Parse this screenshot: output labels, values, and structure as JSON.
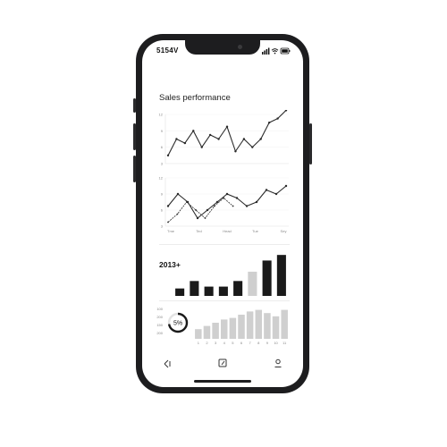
{
  "status": {
    "time": "5154V"
  },
  "page": {
    "title": "Sales performance"
  },
  "chart_data": [
    {
      "type": "line",
      "y_ticks": [
        "12",
        "9",
        "6",
        "3"
      ],
      "ylim": [
        0,
        12
      ],
      "series": [
        {
          "values": [
            2,
            6,
            5,
            8,
            4,
            7,
            6,
            9,
            3,
            6,
            4,
            6,
            10,
            11,
            13
          ]
        }
      ]
    },
    {
      "type": "line",
      "y_ticks": [
        "12",
        "9",
        "6",
        "3"
      ],
      "categories": [
        "Tme",
        "Ted",
        "Head",
        "Tue",
        "Sey"
      ],
      "ylim": [
        0,
        12
      ],
      "series": [
        {
          "values": [
            5,
            8,
            6,
            2,
            4,
            6,
            8,
            7,
            5,
            6,
            9,
            8,
            10
          ]
        },
        {
          "values": [
            1,
            3,
            6,
            4,
            2,
            5,
            7,
            5
          ]
        }
      ]
    },
    {
      "type": "bar",
      "label": "2013+",
      "values": [
        2,
        4,
        2.5,
        2.5,
        4,
        6.5,
        9.5,
        11
      ],
      "highlight": [
        false,
        false,
        false,
        false,
        false,
        true,
        false,
        false
      ],
      "ylim": [
        0,
        12
      ]
    },
    {
      "type": "bar",
      "y_ticks": [
        "100",
        "200",
        "150",
        "200"
      ],
      "categories": [
        "1",
        "2",
        "3",
        "4",
        "5",
        "6",
        "7",
        "8",
        "9",
        "10",
        "11"
      ],
      "values": [
        3,
        4,
        5,
        6,
        6.5,
        7.5,
        8.5,
        9,
        8,
        7,
        9
      ],
      "ylim": [
        0,
        10
      ],
      "donut": {
        "label": "5%",
        "fraction": 0.72
      }
    }
  ],
  "tabs": [
    {
      "icon": "home-icon"
    },
    {
      "icon": "edit-icon"
    },
    {
      "icon": "profile-icon"
    }
  ],
  "colors": {
    "frame": "#1d1d1f",
    "bar_dark": "#1a1a1a",
    "bar_light": "#cfcfcf",
    "line": "#2a2a2a"
  }
}
